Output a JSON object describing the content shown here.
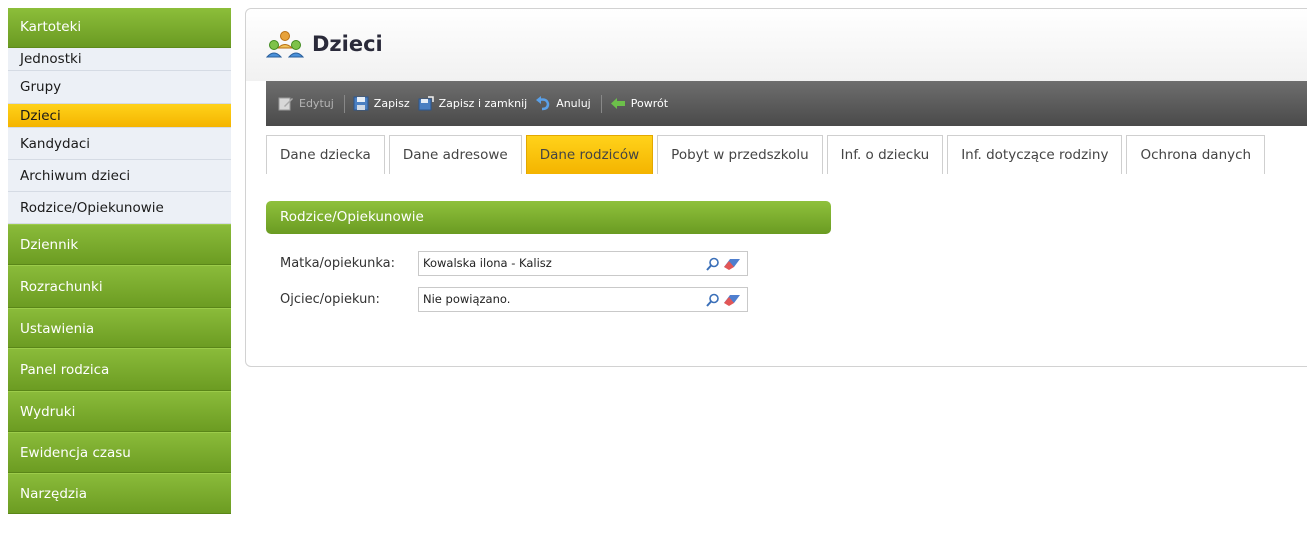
{
  "sidebar": {
    "header": "Kartoteki",
    "sub_items": [
      {
        "label": "Jednostki"
      },
      {
        "label": "Grupy"
      },
      {
        "label": "Dzieci"
      },
      {
        "label": "Kandydaci"
      },
      {
        "label": "Archiwum dzieci"
      },
      {
        "label": "Rodzice/Opiekunowie"
      }
    ],
    "main_items": [
      {
        "label": "Dziennik"
      },
      {
        "label": "Rozrachunki"
      },
      {
        "label": "Ustawienia"
      },
      {
        "label": "Panel rodzica"
      },
      {
        "label": "Wydruki"
      },
      {
        "label": "Ewidencja czasu"
      },
      {
        "label": "Narzędzia"
      }
    ]
  },
  "page": {
    "title": "Dzieci",
    "title_icon": "people-icon"
  },
  "toolbar": {
    "edit": "Edytuj",
    "save": "Zapisz",
    "save_close": "Zapisz i zamknij",
    "cancel": "Anuluj",
    "back": "Powrót"
  },
  "tabs": [
    {
      "label": "Dane dziecka"
    },
    {
      "label": "Dane adresowe"
    },
    {
      "label": "Dane rodziców"
    },
    {
      "label": "Pobyt w przedszkolu"
    },
    {
      "label": "Inf. o dziecku"
    },
    {
      "label": "Inf. dotyczące rodziny"
    },
    {
      "label": "Ochrona danych"
    }
  ],
  "section": {
    "title": "Rodzice/Opiekunowie"
  },
  "form": {
    "mother_label": "Matka/opiekunka:",
    "mother_value": "Kowalska ilona - Kalisz",
    "father_label": "Ojciec/opiekun:",
    "father_value": "Nie powiązano."
  },
  "colors": {
    "accent_green": "#7aab2c",
    "active_yellow": "#f8c200",
    "toolbar_gray": "#5a5a5a"
  }
}
